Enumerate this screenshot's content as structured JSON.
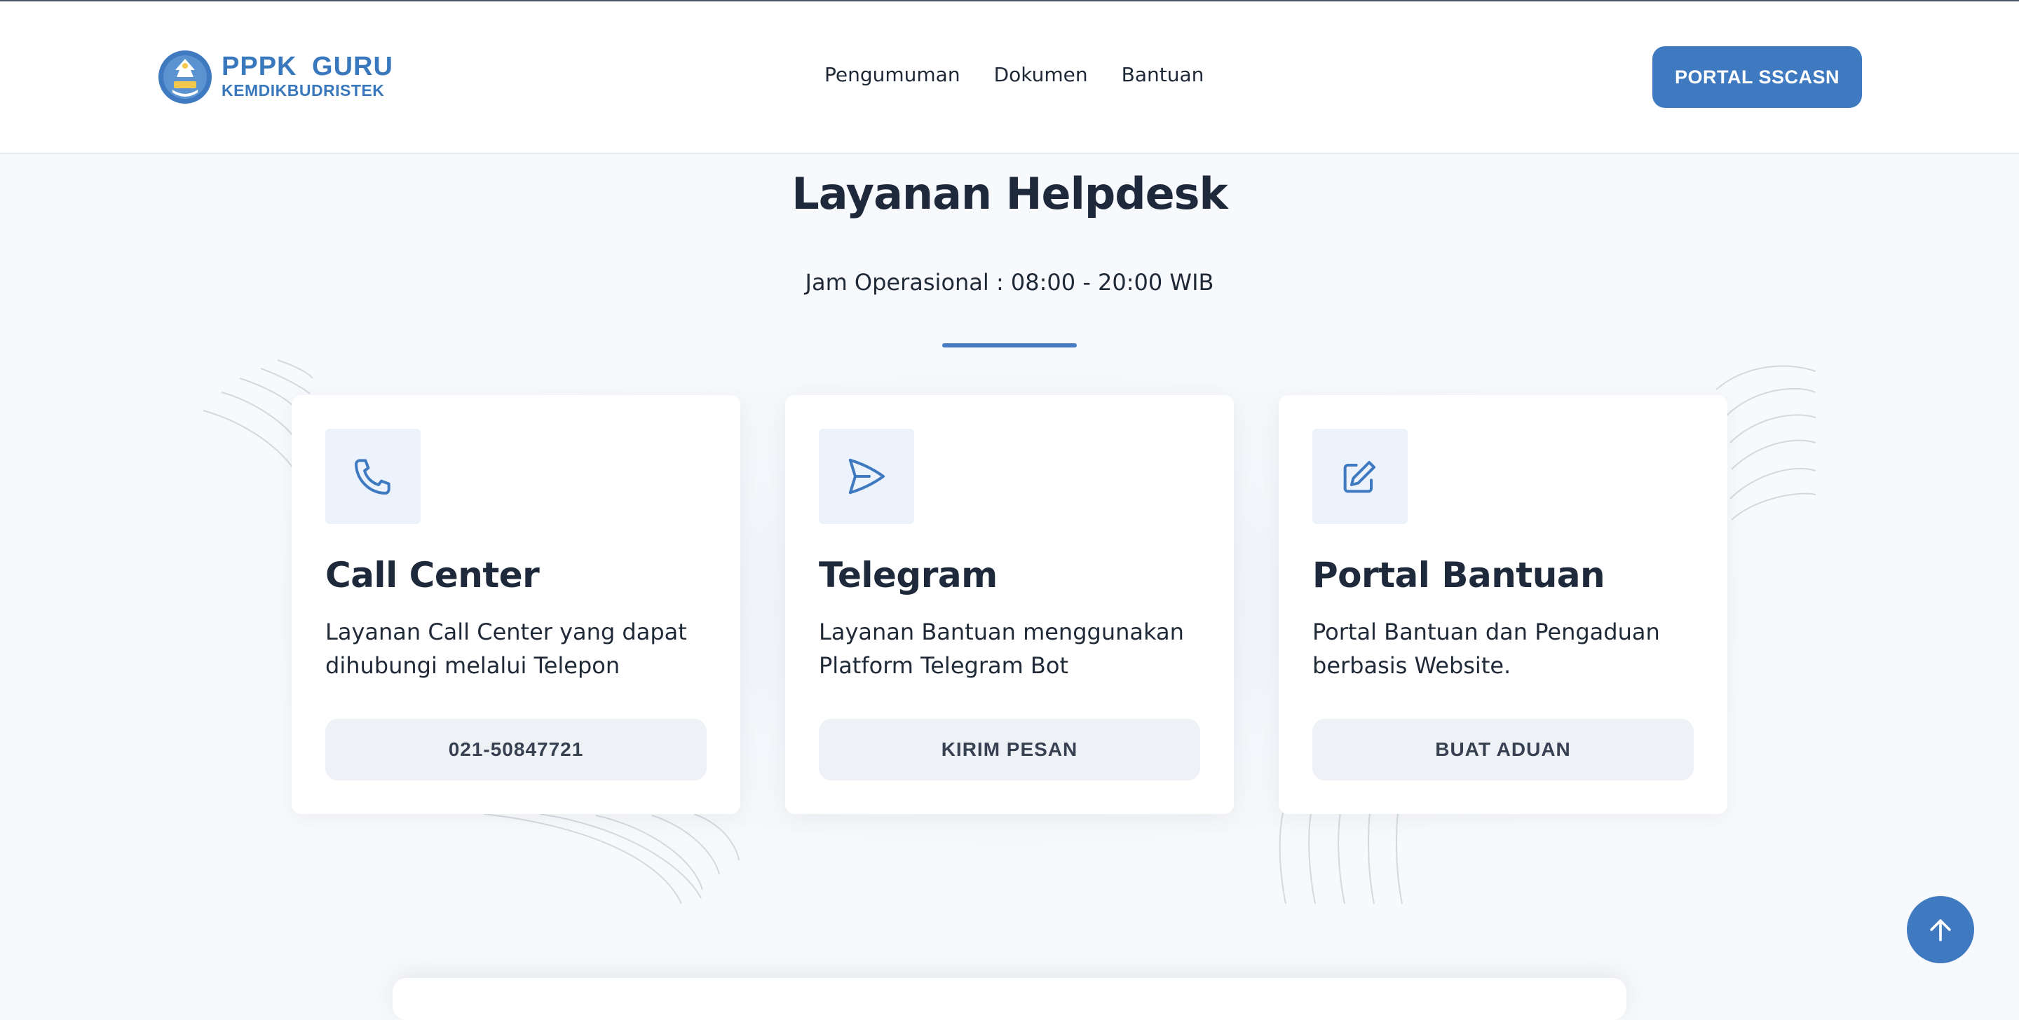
{
  "header": {
    "brand_main": "PPPK  GURU",
    "brand_sub": "KEMDIKBUDRISTEK",
    "logo_icon": "kemdikbud-tut-wuri-handayani-logo",
    "nav": [
      {
        "label": "Pengumuman"
      },
      {
        "label": "Dokumen"
      },
      {
        "label": "Bantuan"
      }
    ],
    "portal_button": "PORTAL SSCASN"
  },
  "section": {
    "title": "Layanan Helpdesk",
    "hours": "Jam Operasional : 08:00 - 20:00 WIB"
  },
  "cards": [
    {
      "icon": "phone-icon",
      "title": "Call Center",
      "description": "Layanan Call Center yang dapat dihubungi melalui Telepon",
      "button": "021-50847721"
    },
    {
      "icon": "send-icon",
      "title": "Telegram",
      "description": "Layanan Bantuan menggunakan Platform Telegram Bot",
      "button": "KIRIM PESAN"
    },
    {
      "icon": "edit-icon",
      "title": "Portal Bantuan",
      "description": "Portal Bantuan dan Pengaduan berbasis Website.",
      "button": "BUAT ADUAN"
    }
  ],
  "scroll_top_icon": "arrow-up-icon",
  "colors": {
    "primary": "#3f7ac1",
    "text_dark": "#1e293b",
    "icon_bg": "#ecf3fd",
    "button_bg": "#eef2f7",
    "page_bg": "#f7f9fc"
  }
}
